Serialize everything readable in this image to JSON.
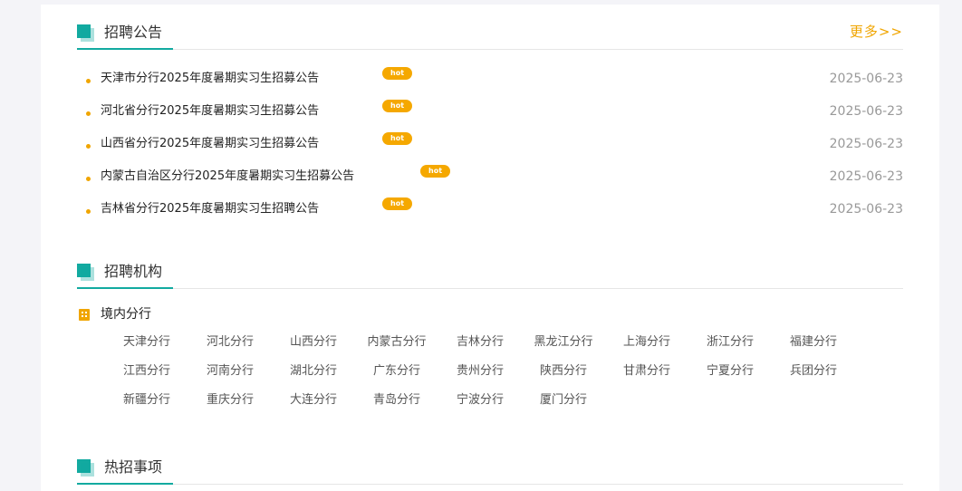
{
  "announcements": {
    "title": "招聘公告",
    "more_label": "更多>>",
    "items": [
      {
        "title": "天津市分行2025年度暑期实习生招募公告",
        "badge": "hot",
        "date": "2025-06-23"
      },
      {
        "title": "河北省分行2025年度暑期实习生招募公告",
        "badge": "hot",
        "date": "2025-06-23"
      },
      {
        "title": "山西省分行2025年度暑期实习生招募公告",
        "badge": "hot",
        "date": "2025-06-23"
      },
      {
        "title": "内蒙古自治区分行2025年度暑期实习生招募公告",
        "badge": "hot",
        "date": "2025-06-23"
      },
      {
        "title": "吉林省分行2025年度暑期实习生招聘公告",
        "badge": "hot",
        "date": "2025-06-23"
      }
    ]
  },
  "institutions": {
    "title": "招聘机构",
    "region_label": "境内分行",
    "branches": [
      "天津分行",
      "河北分行",
      "山西分行",
      "内蒙古分行",
      "吉林分行",
      "黑龙江分行",
      "上海分行",
      "浙江分行",
      "福建分行",
      "江西分行",
      "河南分行",
      "湖北分行",
      "广东分行",
      "贵州分行",
      "陕西分行",
      "甘肃分行",
      "宁夏分行",
      "兵团分行",
      "新疆分行",
      "重庆分行",
      "大连分行",
      "青岛分行",
      "宁波分行",
      "厦门分行"
    ]
  },
  "hot_items": {
    "title": "热招事项"
  },
  "colors": {
    "accent": "#12aaa0",
    "highlight": "#f0a500",
    "background": "#f4f4f8"
  }
}
